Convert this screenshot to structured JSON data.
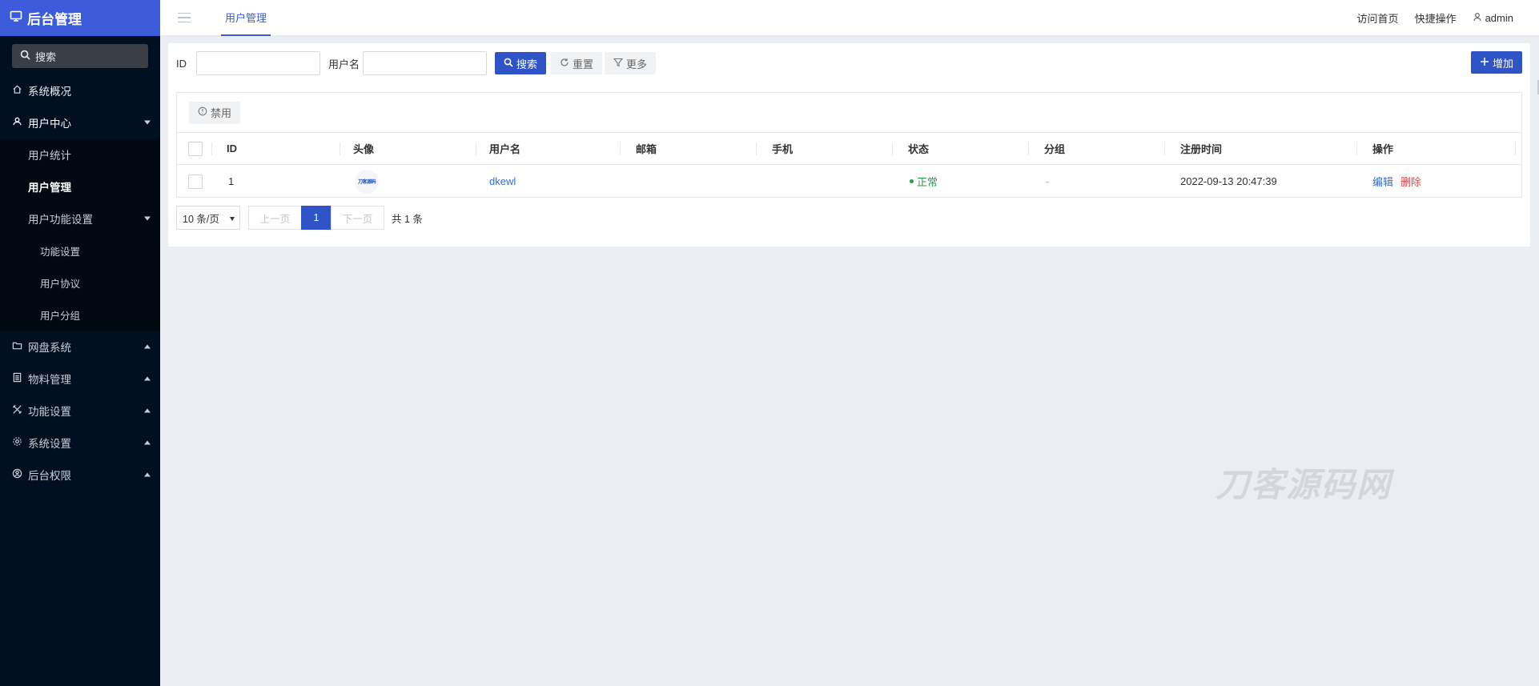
{
  "sidebar": {
    "title": "后台管理",
    "search_placeholder": "搜索",
    "items": {
      "overview": "系统概况",
      "user_center": "用户中心",
      "user_stats": "用户统计",
      "user_manage": "用户管理",
      "user_func_settings": "用户功能设置",
      "func_settings": "功能设置",
      "user_agreement": "用户协议",
      "user_group": "用户分组",
      "netdisk": "网盘系统",
      "materials": "物料管理",
      "features": "功能设置",
      "system_settings": "系统设置",
      "admin_perms": "后台权限"
    }
  },
  "topbar": {
    "tab": "用户管理",
    "visit_home": "访问首页",
    "quick_ops": "快捷操作",
    "username": "admin"
  },
  "filters": {
    "id_label": "ID",
    "username_label": "用户名",
    "search": "搜索",
    "reset": "重置",
    "more": "更多",
    "add": "增加"
  },
  "toolbar": {
    "disable": "禁用"
  },
  "table": {
    "headers": {
      "id": "ID",
      "avatar": "头像",
      "username": "用户名",
      "email": "邮箱",
      "phone": "手机",
      "status": "状态",
      "group": "分组",
      "reg_time": "注册时间",
      "ops": "操作"
    },
    "rows": [
      {
        "id": "1",
        "avatar_text": "刀客源码",
        "username": "dkewl",
        "email": "",
        "phone": "",
        "status": "正常",
        "group": "-",
        "reg_time": "2022-09-13 20:47:39",
        "edit": "编辑",
        "delete": "删除"
      }
    ]
  },
  "pager": {
    "per_page": "10 条/页",
    "prev": "上一页",
    "page": "1",
    "next": "下一页",
    "total": "共 1 条"
  },
  "watermark": "刀客源码网",
  "colors": {
    "primary": "#2f54c7",
    "sidebar_bg": "#011021",
    "brand_bg": "#3b5bdb",
    "success": "#23a049",
    "danger": "#e34b4b"
  }
}
